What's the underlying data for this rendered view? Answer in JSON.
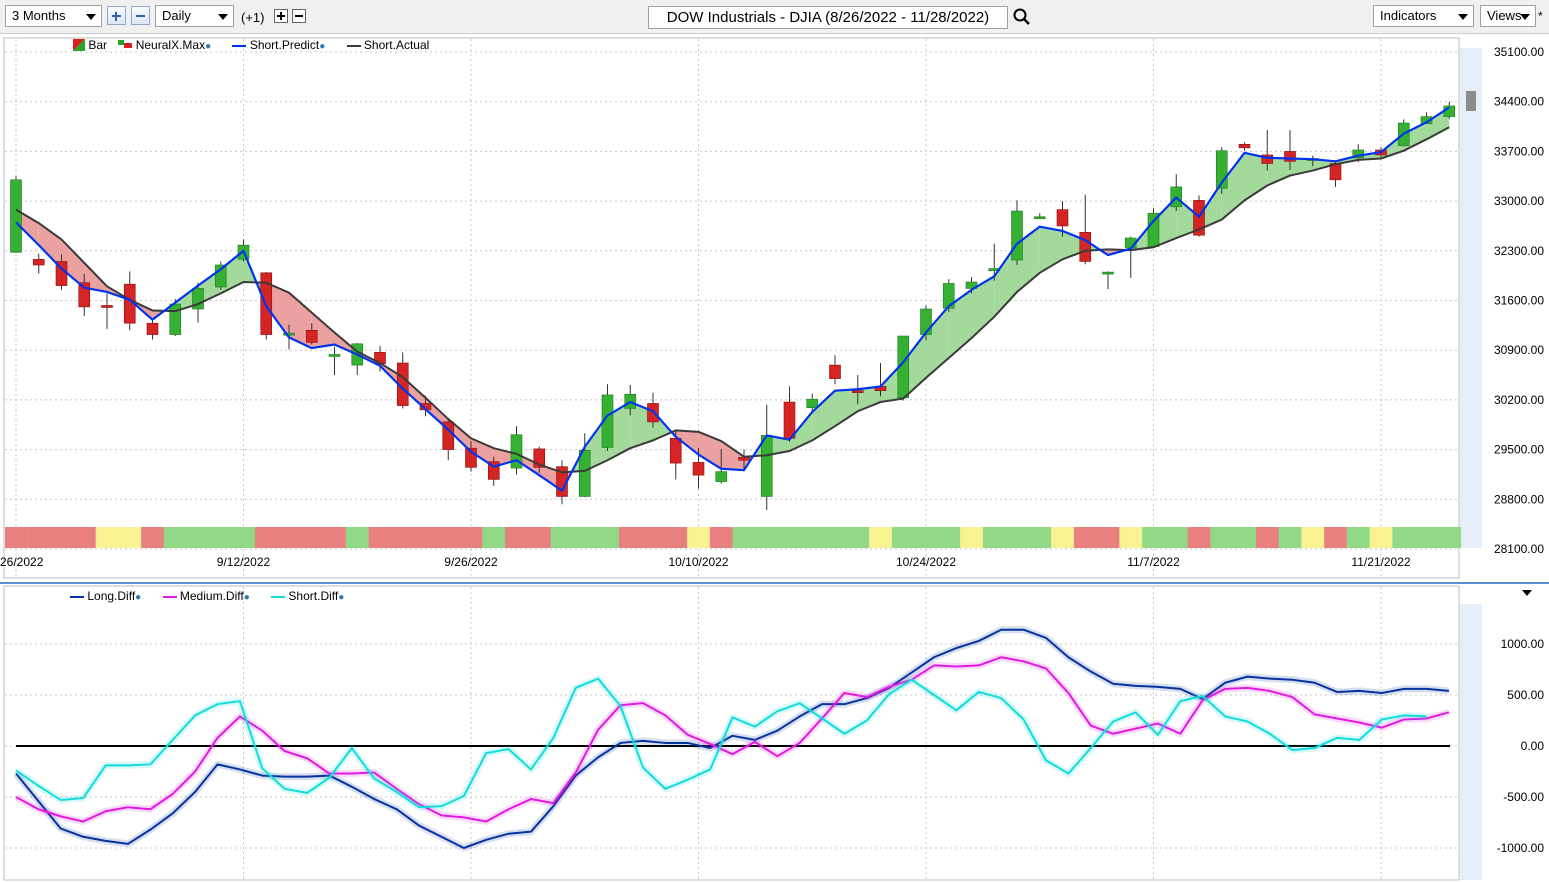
{
  "toolbar": {
    "period": "3 Months",
    "interval": "Daily",
    "offset": "(+1)",
    "title": "DOW Industrials - DJIA (8/26/2022 - 11/28/2022)",
    "indicators": "Indicators",
    "views": "Views"
  },
  "chart_data": [
    {
      "type": "candlestick",
      "title": "DOW Industrials - DJIA (8/26/2022 - 11/28/2022)",
      "legend": [
        "Bar",
        "NeuralX.Max",
        "Short.Predict",
        "Short.Actual"
      ],
      "ylim": [
        28100,
        35100
      ],
      "y_ticks": [
        "35100.00",
        "34400.00",
        "33700.00",
        "33000.00",
        "32300.00",
        "31600.00",
        "30900.00",
        "30200.00",
        "29500.00",
        "28800.00",
        "28100.00"
      ],
      "x_ticks": [
        {
          "label": "26/2022",
          "i": 0
        },
        {
          "label": "9/12/2022",
          "i": 10
        },
        {
          "label": "9/26/2022",
          "i": 20
        },
        {
          "label": "10/10/2022",
          "i": 30
        },
        {
          "label": "10/24/2022",
          "i": 40
        },
        {
          "label": "11/7/2022",
          "i": 50
        },
        {
          "label": "11/21/2022",
          "i": 60
        }
      ],
      "bars": [
        {
          "o": 32280,
          "h": 33350,
          "l": 32270,
          "c": 33300
        },
        {
          "o": 32180,
          "h": 32260,
          "l": 31980,
          "c": 32100
        },
        {
          "o": 32150,
          "h": 32250,
          "l": 31750,
          "c": 31810
        },
        {
          "o": 31850,
          "h": 31980,
          "l": 31380,
          "c": 31510
        },
        {
          "o": 31530,
          "h": 31700,
          "l": 31200,
          "c": 31520
        },
        {
          "o": 31830,
          "h": 32010,
          "l": 31180,
          "c": 31280
        },
        {
          "o": 31280,
          "h": 31320,
          "l": 31050,
          "c": 31120
        },
        {
          "o": 31120,
          "h": 31620,
          "l": 31100,
          "c": 31550
        },
        {
          "o": 31480,
          "h": 31850,
          "l": 31290,
          "c": 31770
        },
        {
          "o": 31790,
          "h": 32150,
          "l": 31750,
          "c": 32100
        },
        {
          "o": 32180,
          "h": 32460,
          "l": 32150,
          "c": 32380
        },
        {
          "o": 31990,
          "h": 32000,
          "l": 31050,
          "c": 31120
        },
        {
          "o": 31130,
          "h": 31260,
          "l": 30910,
          "c": 31140
        },
        {
          "o": 31180,
          "h": 31280,
          "l": 30980,
          "c": 31010
        },
        {
          "o": 30830,
          "h": 30950,
          "l": 30550,
          "c": 30840
        },
        {
          "o": 30690,
          "h": 31000,
          "l": 30550,
          "c": 30990
        },
        {
          "o": 30870,
          "h": 30960,
          "l": 30600,
          "c": 30710
        },
        {
          "o": 30720,
          "h": 30870,
          "l": 30080,
          "c": 30120
        },
        {
          "o": 30150,
          "h": 30260,
          "l": 29970,
          "c": 30060
        },
        {
          "o": 29890,
          "h": 29940,
          "l": 29350,
          "c": 29500
        },
        {
          "o": 29520,
          "h": 29620,
          "l": 29190,
          "c": 29250
        },
        {
          "o": 29330,
          "h": 29400,
          "l": 28990,
          "c": 29080
        },
        {
          "o": 29240,
          "h": 29830,
          "l": 29150,
          "c": 29710
        },
        {
          "o": 29510,
          "h": 29540,
          "l": 29170,
          "c": 29250
        },
        {
          "o": 29260,
          "h": 29350,
          "l": 28730,
          "c": 28840
        },
        {
          "o": 28840,
          "h": 29730,
          "l": 28830,
          "c": 29490
        },
        {
          "o": 29530,
          "h": 30420,
          "l": 29480,
          "c": 30270
        },
        {
          "o": 30080,
          "h": 30410,
          "l": 29980,
          "c": 30280
        },
        {
          "o": 30150,
          "h": 30300,
          "l": 29810,
          "c": 29890
        },
        {
          "o": 29660,
          "h": 29770,
          "l": 29080,
          "c": 29310
        },
        {
          "o": 29320,
          "h": 29520,
          "l": 28950,
          "c": 29140
        },
        {
          "o": 29050,
          "h": 29510,
          "l": 29020,
          "c": 29190
        },
        {
          "o": 29390,
          "h": 29500,
          "l": 29220,
          "c": 29350
        },
        {
          "o": 28840,
          "h": 30130,
          "l": 28650,
          "c": 29700
        },
        {
          "o": 30170,
          "h": 30390,
          "l": 29610,
          "c": 29660
        },
        {
          "o": 30090,
          "h": 30290,
          "l": 30040,
          "c": 30210
        },
        {
          "o": 30690,
          "h": 30830,
          "l": 30420,
          "c": 30500
        },
        {
          "o": 30330,
          "h": 30550,
          "l": 30140,
          "c": 30320
        },
        {
          "o": 30390,
          "h": 30720,
          "l": 30250,
          "c": 30330
        },
        {
          "o": 30230,
          "h": 31080,
          "l": 30190,
          "c": 31100
        },
        {
          "o": 31120,
          "h": 31530,
          "l": 31040,
          "c": 31480
        },
        {
          "o": 31490,
          "h": 31900,
          "l": 31440,
          "c": 31840
        },
        {
          "o": 31770,
          "h": 31930,
          "l": 31700,
          "c": 31860
        },
        {
          "o": 32020,
          "h": 32400,
          "l": 31880,
          "c": 32050
        },
        {
          "o": 32170,
          "h": 33010,
          "l": 32100,
          "c": 32860
        },
        {
          "o": 32780,
          "h": 32830,
          "l": 32750,
          "c": 32780
        },
        {
          "o": 32880,
          "h": 33000,
          "l": 32500,
          "c": 32650
        },
        {
          "o": 32560,
          "h": 33090,
          "l": 32110,
          "c": 32150
        },
        {
          "o": 32000,
          "h": 32010,
          "l": 31760,
          "c": 32000
        },
        {
          "o": 32340,
          "h": 32500,
          "l": 31920,
          "c": 32480
        },
        {
          "o": 32360,
          "h": 32900,
          "l": 32340,
          "c": 32830
        },
        {
          "o": 32920,
          "h": 33380,
          "l": 32860,
          "c": 33200
        },
        {
          "o": 33010,
          "h": 33080,
          "l": 32500,
          "c": 32520
        },
        {
          "o": 33180,
          "h": 33760,
          "l": 33100,
          "c": 33710
        },
        {
          "o": 33800,
          "h": 33830,
          "l": 33710,
          "c": 33750
        },
        {
          "o": 33650,
          "h": 34000,
          "l": 33430,
          "c": 33530
        },
        {
          "o": 33700,
          "h": 34000,
          "l": 33440,
          "c": 33560
        },
        {
          "o": 33600,
          "h": 33640,
          "l": 33490,
          "c": 33600
        },
        {
          "o": 33530,
          "h": 33560,
          "l": 33200,
          "c": 33300
        },
        {
          "o": 33610,
          "h": 33800,
          "l": 33550,
          "c": 33720
        },
        {
          "o": 33720,
          "h": 33760,
          "l": 33620,
          "c": 33650
        },
        {
          "o": 33780,
          "h": 34150,
          "l": 33770,
          "c": 34100
        },
        {
          "o": 34090,
          "h": 34250,
          "l": 34090,
          "c": 34190
        },
        {
          "o": 34190,
          "h": 34400,
          "l": 34160,
          "c": 34340
        }
      ],
      "series": [
        {
          "name": "Short.Predict",
          "color": "#0033ee",
          "values": [
            32700,
            32380,
            32050,
            31780,
            31720,
            31610,
            31330,
            31570,
            31810,
            32040,
            32300,
            31520,
            31080,
            30930,
            30980,
            30840,
            30680,
            30360,
            30070,
            29780,
            29470,
            29260,
            29350,
            29140,
            28920,
            29540,
            29980,
            30170,
            30040,
            29680,
            29430,
            29230,
            29210,
            29700,
            29640,
            30030,
            30330,
            30350,
            30390,
            30730,
            31150,
            31520,
            31750,
            31940,
            32400,
            32640,
            32580,
            32450,
            32240,
            32330,
            32720,
            33050,
            32780,
            33260,
            33680,
            33610,
            33600,
            33590,
            33560,
            33640,
            33690,
            33950,
            34110,
            34320
          ]
        },
        {
          "name": "Short.Actual",
          "color": "#3a3a3a",
          "values": [
            32880,
            32690,
            32460,
            32130,
            31800,
            31610,
            31460,
            31450,
            31550,
            31700,
            31860,
            31850,
            31710,
            31430,
            31150,
            30880,
            30720,
            30520,
            30230,
            29930,
            29660,
            29520,
            29440,
            29290,
            29180,
            29200,
            29350,
            29520,
            29630,
            29770,
            29750,
            29620,
            29400,
            29420,
            29480,
            29630,
            29830,
            30040,
            30170,
            30220,
            30510,
            30790,
            31070,
            31370,
            31720,
            31990,
            32180,
            32300,
            32320,
            32310,
            32350,
            32480,
            32600,
            32740,
            33010,
            33220,
            33360,
            33430,
            33520,
            33580,
            33600,
            33710,
            33870,
            34040
          ]
        },
        {
          "name": "NeuralX.Max",
          "colors": [
            "#e88080",
            "#f9f292",
            "#91d986"
          ],
          "values": [
            "r",
            "r",
            "r",
            "r",
            "y",
            "y",
            "r",
            "g",
            "g",
            "g",
            "g",
            "r",
            "r",
            "r",
            "r",
            "g",
            "r",
            "r",
            "r",
            "r",
            "r",
            "g",
            "r",
            "r",
            "g",
            "g",
            "g",
            "r",
            "r",
            "r",
            "y",
            "r",
            "g",
            "g",
            "g",
            "g",
            "g",
            "g",
            "y",
            "g",
            "g",
            "g",
            "y",
            "g",
            "g",
            "g",
            "y",
            "r",
            "r",
            "y",
            "g",
            "g",
            "r",
            "g",
            "g",
            "r",
            "g",
            "y",
            "r",
            "g",
            "y",
            "g",
            "g",
            "g"
          ]
        }
      ]
    },
    {
      "type": "line",
      "legend": [
        "Long.Diff",
        "Medium.Diff",
        "Short.Diff"
      ],
      "ylim": [
        -1000,
        1000
      ],
      "y_ticks": [
        "1000.00",
        "500.00",
        "0.00",
        "-500.00",
        "-1000.00"
      ],
      "series": [
        {
          "name": "Long.Diff",
          "color": "#06339e",
          "values": [
            -270,
            -540,
            -810,
            -890,
            -930,
            -960,
            -820,
            -660,
            -450,
            -180,
            -230,
            -290,
            -300,
            -300,
            -290,
            -400,
            -520,
            -620,
            -780,
            -890,
            -1000,
            -920,
            -860,
            -840,
            -590,
            -290,
            -110,
            30,
            50,
            30,
            30,
            -20,
            100,
            60,
            150,
            290,
            410,
            410,
            470,
            570,
            720,
            870,
            960,
            1030,
            1140,
            1140,
            1060,
            870,
            730,
            610,
            590,
            580,
            560,
            460,
            620,
            680,
            660,
            650,
            620,
            530,
            540,
            520,
            560,
            560,
            540
          ]
        },
        {
          "name": "Medium.Diff",
          "color": "#e11ae1",
          "values": [
            -500,
            -620,
            -690,
            -740,
            -640,
            -600,
            -620,
            -470,
            -250,
            80,
            290,
            150,
            -50,
            -120,
            -270,
            -270,
            -260,
            -420,
            -570,
            -680,
            -700,
            -740,
            -620,
            -520,
            -560,
            -260,
            160,
            400,
            420,
            300,
            110,
            20,
            -80,
            40,
            -100,
            30,
            270,
            520,
            480,
            580,
            650,
            790,
            780,
            790,
            870,
            830,
            760,
            520,
            200,
            120,
            170,
            220,
            120,
            450,
            560,
            570,
            540,
            480,
            310,
            270,
            230,
            180,
            260,
            270,
            330
          ]
        },
        {
          "name": "Short.Diff",
          "color": "#12dcdc",
          "values": [
            -240,
            -390,
            -530,
            -510,
            -190,
            -190,
            -180,
            60,
            300,
            410,
            440,
            -220,
            -420,
            -460,
            -310,
            -20,
            -320,
            -450,
            -600,
            -590,
            -490,
            -70,
            -30,
            -230,
            80,
            570,
            660,
            390,
            -210,
            -420,
            -330,
            -230,
            280,
            190,
            340,
            420,
            270,
            120,
            250,
            510,
            650,
            500,
            350,
            530,
            470,
            260,
            -140,
            -270,
            -20,
            240,
            330,
            110,
            440,
            490,
            290,
            240,
            120,
            -40,
            -20,
            80,
            60,
            260,
            300,
            290
          ]
        }
      ]
    }
  ]
}
